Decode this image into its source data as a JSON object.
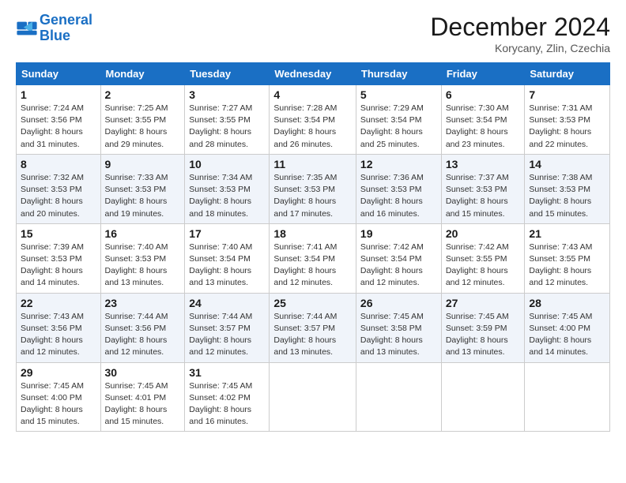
{
  "header": {
    "logo_line1": "General",
    "logo_line2": "Blue",
    "month": "December 2024",
    "location": "Korycany, Zlin, Czechia"
  },
  "weekdays": [
    "Sunday",
    "Monday",
    "Tuesday",
    "Wednesday",
    "Thursday",
    "Friday",
    "Saturday"
  ],
  "weeks": [
    [
      {
        "day": "1",
        "sunrise": "7:24 AM",
        "sunset": "3:56 PM",
        "daylight": "8 hours and 31 minutes."
      },
      {
        "day": "2",
        "sunrise": "7:25 AM",
        "sunset": "3:55 PM",
        "daylight": "8 hours and 29 minutes."
      },
      {
        "day": "3",
        "sunrise": "7:27 AM",
        "sunset": "3:55 PM",
        "daylight": "8 hours and 28 minutes."
      },
      {
        "day": "4",
        "sunrise": "7:28 AM",
        "sunset": "3:54 PM",
        "daylight": "8 hours and 26 minutes."
      },
      {
        "day": "5",
        "sunrise": "7:29 AM",
        "sunset": "3:54 PM",
        "daylight": "8 hours and 25 minutes."
      },
      {
        "day": "6",
        "sunrise": "7:30 AM",
        "sunset": "3:54 PM",
        "daylight": "8 hours and 23 minutes."
      },
      {
        "day": "7",
        "sunrise": "7:31 AM",
        "sunset": "3:53 PM",
        "daylight": "8 hours and 22 minutes."
      }
    ],
    [
      {
        "day": "8",
        "sunrise": "7:32 AM",
        "sunset": "3:53 PM",
        "daylight": "8 hours and 20 minutes."
      },
      {
        "day": "9",
        "sunrise": "7:33 AM",
        "sunset": "3:53 PM",
        "daylight": "8 hours and 19 minutes."
      },
      {
        "day": "10",
        "sunrise": "7:34 AM",
        "sunset": "3:53 PM",
        "daylight": "8 hours and 18 minutes."
      },
      {
        "day": "11",
        "sunrise": "7:35 AM",
        "sunset": "3:53 PM",
        "daylight": "8 hours and 17 minutes."
      },
      {
        "day": "12",
        "sunrise": "7:36 AM",
        "sunset": "3:53 PM",
        "daylight": "8 hours and 16 minutes."
      },
      {
        "day": "13",
        "sunrise": "7:37 AM",
        "sunset": "3:53 PM",
        "daylight": "8 hours and 15 minutes."
      },
      {
        "day": "14",
        "sunrise": "7:38 AM",
        "sunset": "3:53 PM",
        "daylight": "8 hours and 15 minutes."
      }
    ],
    [
      {
        "day": "15",
        "sunrise": "7:39 AM",
        "sunset": "3:53 PM",
        "daylight": "8 hours and 14 minutes."
      },
      {
        "day": "16",
        "sunrise": "7:40 AM",
        "sunset": "3:53 PM",
        "daylight": "8 hours and 13 minutes."
      },
      {
        "day": "17",
        "sunrise": "7:40 AM",
        "sunset": "3:54 PM",
        "daylight": "8 hours and 13 minutes."
      },
      {
        "day": "18",
        "sunrise": "7:41 AM",
        "sunset": "3:54 PM",
        "daylight": "8 hours and 12 minutes."
      },
      {
        "day": "19",
        "sunrise": "7:42 AM",
        "sunset": "3:54 PM",
        "daylight": "8 hours and 12 minutes."
      },
      {
        "day": "20",
        "sunrise": "7:42 AM",
        "sunset": "3:55 PM",
        "daylight": "8 hours and 12 minutes."
      },
      {
        "day": "21",
        "sunrise": "7:43 AM",
        "sunset": "3:55 PM",
        "daylight": "8 hours and 12 minutes."
      }
    ],
    [
      {
        "day": "22",
        "sunrise": "7:43 AM",
        "sunset": "3:56 PM",
        "daylight": "8 hours and 12 minutes."
      },
      {
        "day": "23",
        "sunrise": "7:44 AM",
        "sunset": "3:56 PM",
        "daylight": "8 hours and 12 minutes."
      },
      {
        "day": "24",
        "sunrise": "7:44 AM",
        "sunset": "3:57 PM",
        "daylight": "8 hours and 12 minutes."
      },
      {
        "day": "25",
        "sunrise": "7:44 AM",
        "sunset": "3:57 PM",
        "daylight": "8 hours and 13 minutes."
      },
      {
        "day": "26",
        "sunrise": "7:45 AM",
        "sunset": "3:58 PM",
        "daylight": "8 hours and 13 minutes."
      },
      {
        "day": "27",
        "sunrise": "7:45 AM",
        "sunset": "3:59 PM",
        "daylight": "8 hours and 13 minutes."
      },
      {
        "day": "28",
        "sunrise": "7:45 AM",
        "sunset": "4:00 PM",
        "daylight": "8 hours and 14 minutes."
      }
    ],
    [
      {
        "day": "29",
        "sunrise": "7:45 AM",
        "sunset": "4:00 PM",
        "daylight": "8 hours and 15 minutes."
      },
      {
        "day": "30",
        "sunrise": "7:45 AM",
        "sunset": "4:01 PM",
        "daylight": "8 hours and 15 minutes."
      },
      {
        "day": "31",
        "sunrise": "7:45 AM",
        "sunset": "4:02 PM",
        "daylight": "8 hours and 16 minutes."
      },
      null,
      null,
      null,
      null
    ]
  ]
}
